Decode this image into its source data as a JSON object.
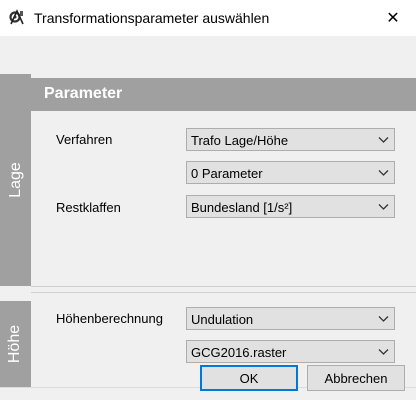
{
  "window": {
    "title": "Transformationsparameter auswählen",
    "close_glyph": "✕",
    "app_icon": "gear-compass-icon"
  },
  "section_header": "Parameter",
  "sections": {
    "lage": "Lage",
    "hoehe": "Höhe"
  },
  "lage": {
    "verfahren_label": "Verfahren",
    "verfahren_value": "Trafo Lage/Höhe",
    "parameter_value": "0 Parameter",
    "restklaffen_label": "Restklaffen",
    "restklaffen_value": "Bundesland [1/s²]"
  },
  "hoehe": {
    "berechnung_label": "Höhenberechnung",
    "berechnung_value": "Undulation",
    "raster_value": "GCG2016.raster"
  },
  "buttons": {
    "ok": "OK",
    "cancel": "Abbrechen"
  },
  "colors": {
    "section_gray": "#a0a0a0",
    "background": "#f0f0f0",
    "focus_blue": "#0078d7"
  }
}
